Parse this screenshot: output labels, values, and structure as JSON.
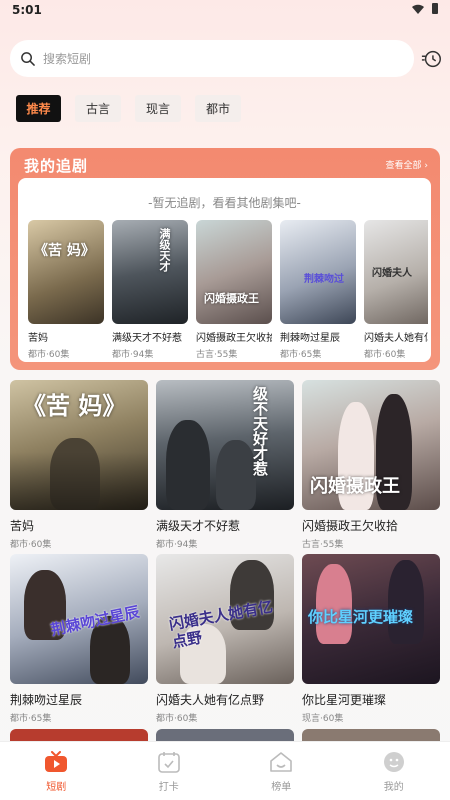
{
  "status_bar": {
    "time": "5:01"
  },
  "search": {
    "placeholder": "搜索短剧"
  },
  "tabs": [
    {
      "label": "推荐",
      "active": true
    },
    {
      "label": "古言",
      "active": false
    },
    {
      "label": "现言",
      "active": false
    },
    {
      "label": "都市",
      "active": false
    }
  ],
  "follow": {
    "title": "我的追剧",
    "view_all": "查看全部 ›",
    "empty_text": "-暂无追剧，看看其他剧集吧-",
    "items": [
      {
        "title": "苦妈",
        "meta": "都市·60集"
      },
      {
        "title": "满级天才不好惹",
        "meta": "都市·94集"
      },
      {
        "title": "闪婚摄政王欠收拾",
        "meta": "古言·55集"
      },
      {
        "title": "荆棘吻过星辰",
        "meta": "都市·65集"
      },
      {
        "title": "闪婚夫人她有亿点野",
        "meta": "都市·60集"
      }
    ]
  },
  "dramas": [
    {
      "title": "苦妈",
      "meta": "都市·60集",
      "poster_text": "《苦 妈》"
    },
    {
      "title": "满级天才不好惹",
      "meta": "都市·94集",
      "poster_text": "级不天好才惹"
    },
    {
      "title": "闪婚摄政王欠收拾",
      "meta": "古言·55集",
      "poster_text": "闪婚摄政王"
    },
    {
      "title": "荆棘吻过星辰",
      "meta": "都市·65集",
      "poster_text": "荆棘吻过星辰"
    },
    {
      "title": "闪婚夫人她有亿点野",
      "meta": "都市·60集",
      "poster_text": "闪婚夫人她有亿点野"
    },
    {
      "title": "你比星河更璀璨",
      "meta": "现言·60集",
      "poster_text": "你比星河更璀璨"
    }
  ],
  "nav": [
    {
      "label": "短剧",
      "icon": "tv-icon",
      "active": true
    },
    {
      "label": "打卡",
      "icon": "calendar-check-icon",
      "active": false
    },
    {
      "label": "榜单",
      "icon": "ranking-house-icon",
      "active": false
    },
    {
      "label": "我的",
      "icon": "profile-face-icon",
      "active": false
    }
  ],
  "colors": {
    "accent": "#f0572e",
    "follow_panel": "#f38a70",
    "tab_active_text": "#ff8a4b"
  }
}
